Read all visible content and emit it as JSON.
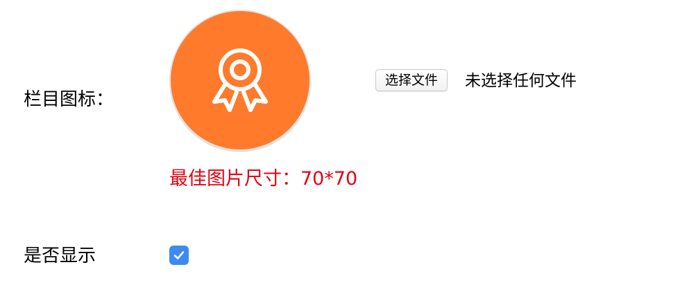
{
  "form": {
    "icon_field": {
      "label": "栏目图标：",
      "icon": "award-ribbon-icon",
      "icon_background_color": "#ff7b2b",
      "file_button_label": "选择文件",
      "file_status": "未选择任何文件",
      "size_hint": "最佳图片尺寸：70*70",
      "hint_color": "#e60012"
    },
    "visibility_field": {
      "label": "是否显示",
      "checked": true,
      "checkbox_color": "#3d8bf0"
    }
  }
}
